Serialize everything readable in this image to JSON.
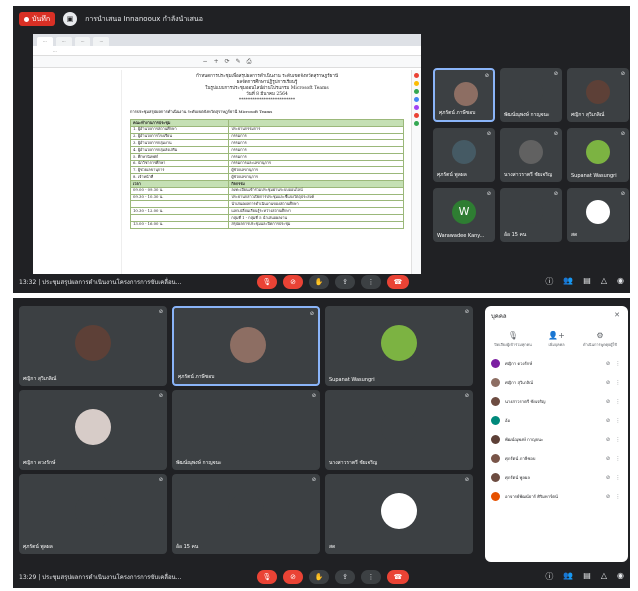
{
  "shot1": {
    "rec_label": "บันทึก",
    "presenting": "การนำเสนอ Innanooux กำลังนำเสนอ",
    "doc_tabs": [
      "...",
      "...",
      "...",
      "..."
    ],
    "doc_url": "...",
    "doc_heading": [
      "กำหนดการประชุมเพื่อสรุปผลการดำเนินงาน ระดับเขตจังหวัดสุราษฎร์ธานี",
      "ผลจัดการศึกษาปฏิรูปการเรียนรู้",
      "ในรูปแบบการประชุมออนไลน์ผ่านโปรแกรม Microsoft Teams",
      "วันที่ 8 มีนาคม 2564",
      "*************************"
    ],
    "doc_subhead": "การประชุมสรุปผลการดำเนินงาน ระดับเขตจังหวัดสุราษฎร์ธานี Microsoft Teams",
    "doc_rows": [
      [
        "คณะทำงานการประชุม",
        ""
      ],
      [
        "1. ผู้อำนวยการสถานศึกษา",
        "ประธานกรรมการ"
      ],
      [
        "2. ผู้อำนวยการโรงเรียน",
        "กรรมการ"
      ],
      [
        "3. ผู้อำนวยการกลุ่มงาน",
        "กรรมการ"
      ],
      [
        "4. ผู้อำนวยการกลุ่มส่งเสริม",
        "กรรมการ"
      ],
      [
        "5. ศึกษานิเทศก์",
        "กรรมการ"
      ],
      [
        "6. นักวิชาการศึกษา",
        "กรรมการและเลขานุการ"
      ],
      [
        "7. ผู้ช่วยเลขานุการ",
        "ผู้ช่วยเลขานุการ"
      ],
      [
        "8. เจ้าหน้าที่",
        "ผู้ช่วยเลขานุการ"
      ],
      [
        "เวลา",
        "กิจกรรม"
      ],
      [
        "09.00 - 09.30 น.",
        "ลงทะเบียนเข้าร่วมประชุมผ่านระบบออนไลน์"
      ],
      [
        "09.30 - 10.30 น.",
        "ประธานกล่าวเปิดการประชุมและชี้แจงวัตถุประสงค์"
      ],
      [
        "",
        "นำเสนอผลการดำเนินงานของสถานศึกษา"
      ],
      [
        "10.30 - 12.00 น.",
        "แลกเปลี่ยนเรียนรู้ระหว่างสถานศึกษา"
      ],
      [
        "",
        "กลุ่มที่ 1 - กลุ่มที่ 5 นำเสนอผลงาน"
      ],
      [
        "13.00 - 16.00 น.",
        "สรุปผลการประชุมและปิดการประชุม"
      ]
    ],
    "tiles": [
      {
        "name": "ศุภรัตน์ ภาษีชอบ",
        "color": "#8d6e63",
        "active": true
      },
      {
        "name": "พัฒน์ณุพงษ์ กาญจนะ",
        "color": "#3c4043"
      },
      {
        "name": "ศญิกา สุวิเภลิณ์",
        "color": "#5d4037"
      },
      {
        "name": "ศุภรัตน์ พูลผล",
        "color": "#455a64"
      },
      {
        "name": "นางสาวราตรี ชัยเจริญ",
        "color": "#616161"
      },
      {
        "name": "Supanat Wasungri",
        "color": "#7cb342"
      },
      {
        "name": "Warawadee Kany...",
        "initial": "W",
        "color": "#2e7d32"
      },
      {
        "name": "อ้อ 15 คน",
        "color": "#3c4043"
      },
      {
        "name": "สด",
        "color": "#ffffff"
      }
    ],
    "meeting_time": "13:32",
    "meeting_title": "ประชุมสรุปผลการดำเนินงานโครงการการขับเคลื่อน...",
    "controls": [
      "mic-off",
      "cam-off",
      "hand",
      "present",
      "more",
      "end-call"
    ]
  },
  "shot2": {
    "tiles": [
      {
        "name": "ศญิกา สุวิเภลิณ์",
        "color": "#5d4037"
      },
      {
        "name": "ศุภรัตน์ ภาษีชอบ",
        "color": "#8d6e63",
        "active": true
      },
      {
        "name": "Supanat Wasungri",
        "color": "#7cb342"
      },
      {
        "name": "ศญิกา ดวงรักษ์",
        "color": "#d7ccc8"
      },
      {
        "name": "พัฒน์ณุพงษ์ กาญจนะ",
        "color": "#3c4043"
      },
      {
        "name": "นางสาวราตรี ชัยเจริญ",
        "color": "#3c4043"
      },
      {
        "name": "ศุภรัตน์ พูลผล",
        "color": "#3c4043"
      },
      {
        "name": "อ้อ 15 คน",
        "color": "#3c4043"
      },
      {
        "name": "สด",
        "color": "#ffffff"
      }
    ],
    "people_panel": {
      "title": "บุคคล",
      "actions": [
        "ปิดเสียงผู้เข้าร่วมทุกคน",
        "เพิ่มบุคคล",
        "ดำเนินการพูดคุยผู้ใช้"
      ],
      "people": [
        {
          "name": "ศญิกา ดวงรักษ์",
          "color": "#7b1fa2"
        },
        {
          "name": "ศญิกา สุวิเภลิณ์",
          "color": "#8d6e63"
        },
        {
          "name": "นางสาวราตรี ชัยเจริญ",
          "color": "#6d4c41"
        },
        {
          "name": "อ้อ",
          "color": "#00897b"
        },
        {
          "name": "พัฒน์ณุพงษ์ กาญจนะ",
          "color": "#5d4037"
        },
        {
          "name": "ศุภรัตน์ ภาษีชอบ",
          "color": "#795548"
        },
        {
          "name": "ศุภรัตน์ พูลผล",
          "color": "#6d4c41"
        },
        {
          "name": "อาจารย์พัฒน์ธาร์ ศิริมหาร์ตน์",
          "color": "#e65100"
        }
      ]
    },
    "meeting_time": "13:29",
    "meeting_title": "ประชุมสรุปผลการดำเนินงานโครงการการขับเคลื่อน..."
  }
}
